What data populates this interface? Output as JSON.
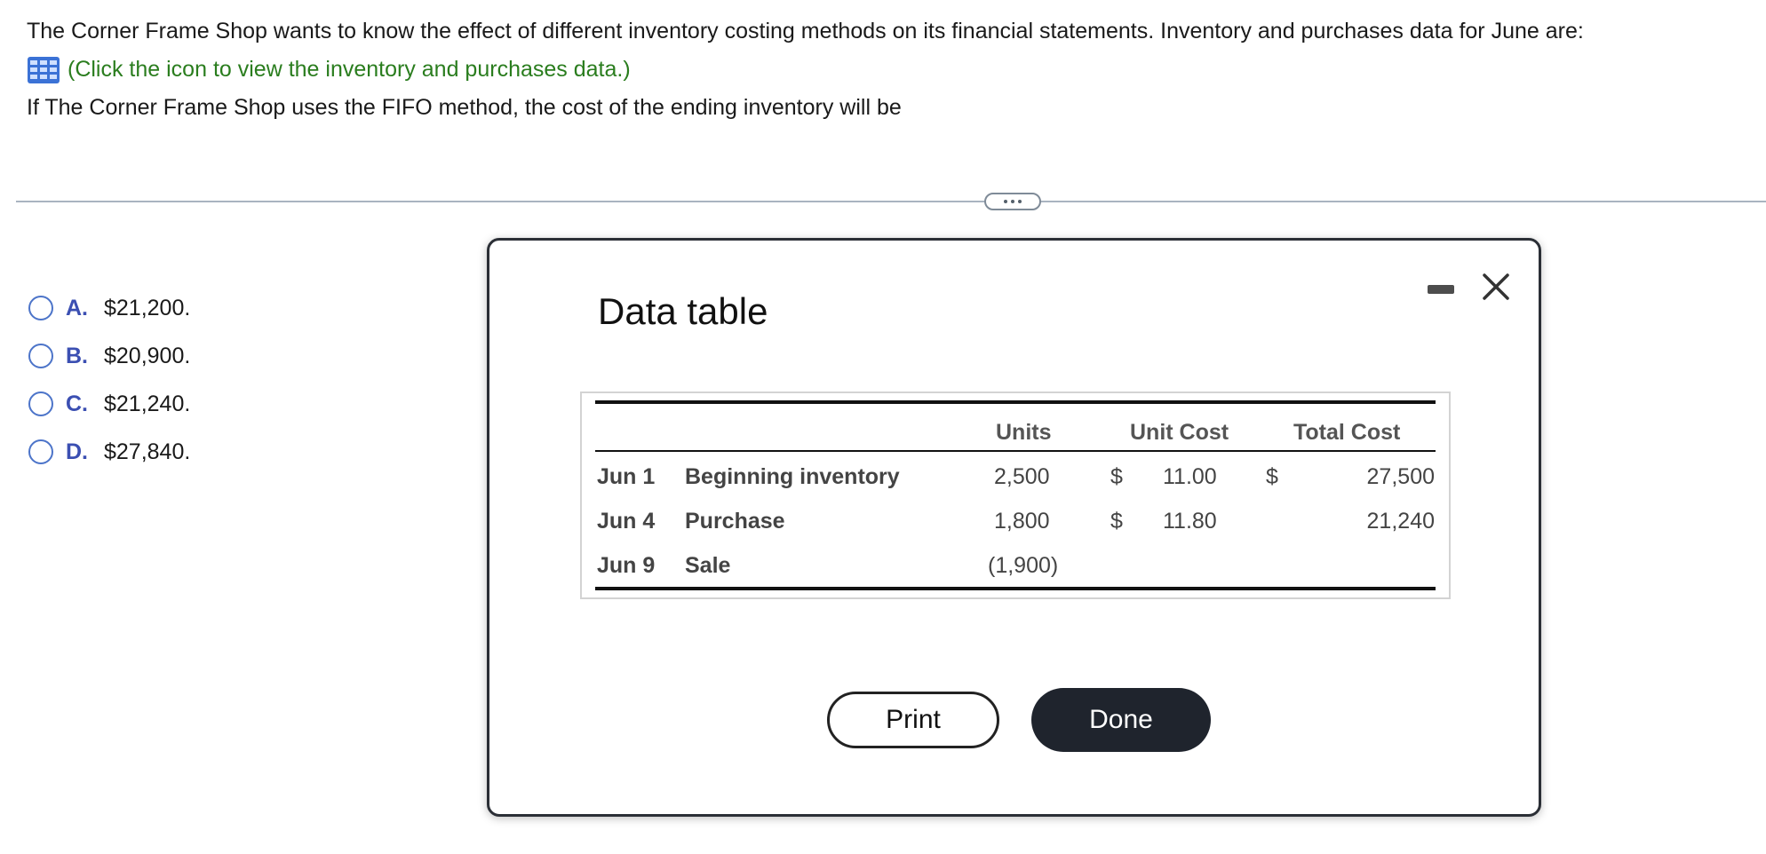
{
  "question": {
    "intro": "The Corner Frame Shop wants to know the effect of different inventory costing methods on its financial statements. Inventory and purchases data for June are:",
    "data_link": "(Click the icon to view the inventory and purchases data.)",
    "prompt": "If The Corner Frame Shop uses the FIFO method, the cost of the ending inventory will be"
  },
  "choices": [
    {
      "letter": "A.",
      "text": "$21,200."
    },
    {
      "letter": "B.",
      "text": "$20,900."
    },
    {
      "letter": "C.",
      "text": "$21,240."
    },
    {
      "letter": "D.",
      "text": "$27,840."
    }
  ],
  "modal": {
    "title": "Data table",
    "headers": {
      "units": "Units",
      "unit_cost": "Unit Cost",
      "total_cost": "Total Cost"
    },
    "rows": [
      {
        "date": "Jun 1",
        "desc": "Beginning inventory",
        "units": "2,500",
        "cur1": "$",
        "unit_cost": "11.00",
        "cur2": "$",
        "total_cost": "27,500"
      },
      {
        "date": "Jun 4",
        "desc": "Purchase",
        "units": "1,800",
        "cur1": "$",
        "unit_cost": "11.80",
        "cur2": "",
        "total_cost": "21,240"
      },
      {
        "date": "Jun 9",
        "desc": "Sale",
        "units": "(1,900)",
        "cur1": "",
        "unit_cost": "",
        "cur2": "",
        "total_cost": ""
      }
    ],
    "print_label": "Print",
    "done_label": "Done"
  },
  "colors": {
    "link_green": "#2a7d1e",
    "choice_blue": "#3b4fb2",
    "done_bg": "#1f242d"
  }
}
